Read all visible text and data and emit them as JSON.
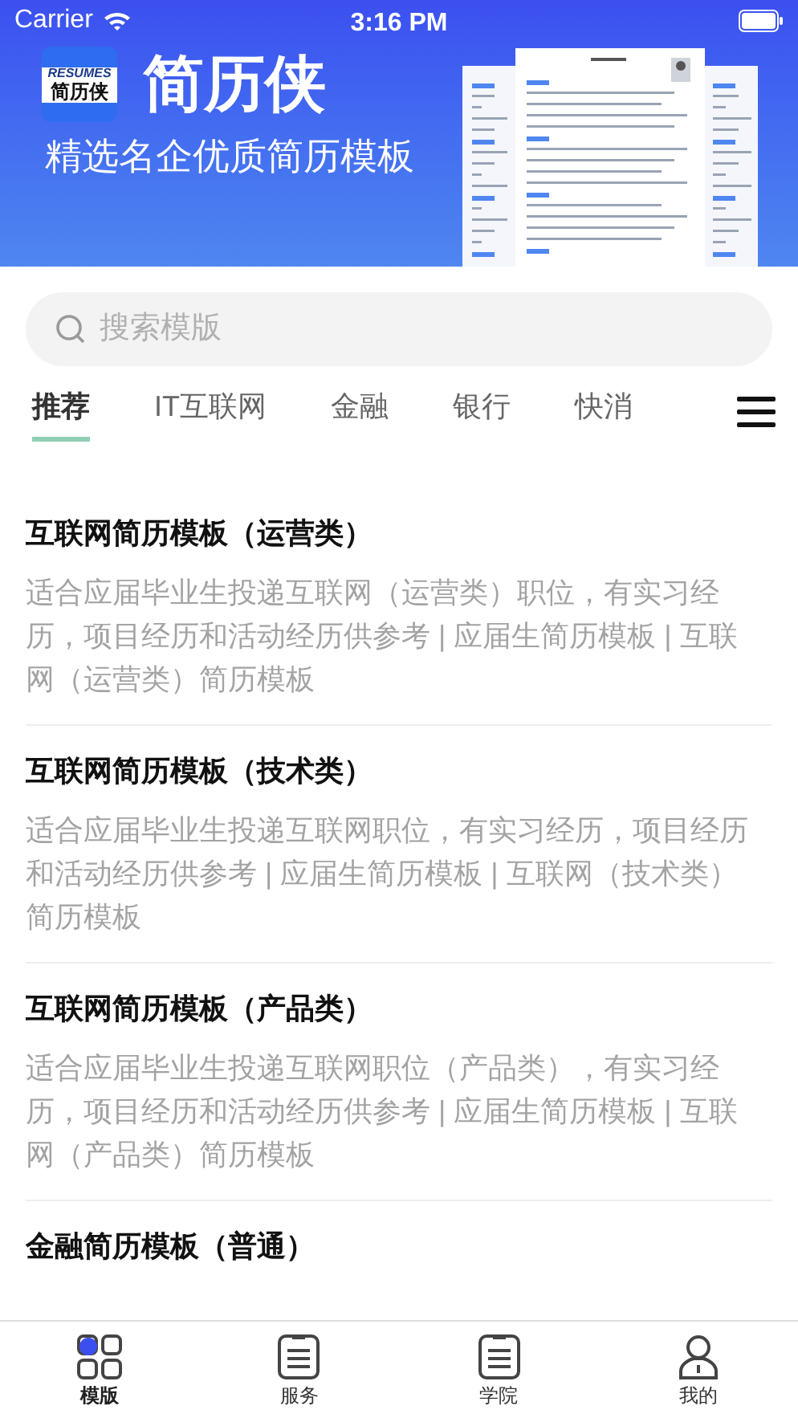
{
  "status_bar": {
    "carrier": "Carrier",
    "time": "3:16 PM"
  },
  "banner": {
    "logo_top": "RESUMES",
    "logo_bottom": "简历侠",
    "title": "简历侠",
    "subtitle": "精选名企优质简历模板"
  },
  "search": {
    "placeholder": "搜索模版"
  },
  "tabs": [
    {
      "label": "推荐",
      "selected": true
    },
    {
      "label": "IT互联网",
      "selected": false
    },
    {
      "label": "金融",
      "selected": false
    },
    {
      "label": "银行",
      "selected": false
    },
    {
      "label": "快消",
      "selected": false
    }
  ],
  "templates": [
    {
      "title": "互联网简历模板（运营类）",
      "description": "适合应届毕业生投递互联网（运营类）职位，有实习经历，项目经历和活动经历供参考 | 应届生简历模板 | 互联网（运营类）简历模板"
    },
    {
      "title": "互联网简历模板（技术类）",
      "description": "适合应届毕业生投递互联网职位，有实习经历，项目经历和活动经历供参考 | 应届生简历模板 | 互联网（技术类）简历模板"
    },
    {
      "title": "互联网简历模板（产品类）",
      "description": "适合应届毕业生投递互联网职位（产品类），有实习经历，项目经历和活动经历供参考 | 应届生简历模板 | 互联网（产品类）简历模板"
    },
    {
      "title": "金融简历模板（普通）"
    }
  ],
  "tab_bar": [
    {
      "label": "模版",
      "kind": "grid",
      "selected": true
    },
    {
      "label": "服务",
      "kind": "doc",
      "selected": false
    },
    {
      "label": "学院",
      "kind": "doc",
      "selected": false
    },
    {
      "label": "我的",
      "kind": "person",
      "selected": false
    }
  ]
}
